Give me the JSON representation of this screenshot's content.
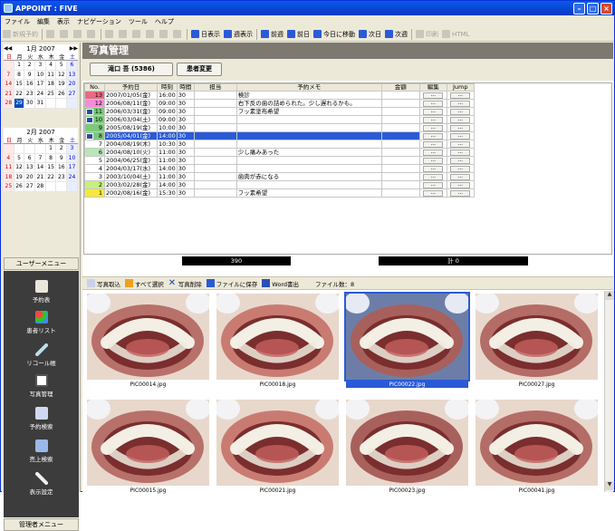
{
  "window": {
    "title": "APPOINT : FIVE"
  },
  "menu": [
    "ファイル",
    "編集",
    "表示",
    "ナビゲーション",
    "ツール",
    "ヘルプ"
  ],
  "toolbar": [
    {
      "label": "新規予約",
      "enabled": false
    },
    {
      "label": "日表示",
      "enabled": true
    },
    {
      "label": "週表示",
      "enabled": true
    },
    {
      "label": "前週",
      "enabled": true
    },
    {
      "label": "前日",
      "enabled": true
    },
    {
      "label": "今日に移動",
      "enabled": true
    },
    {
      "label": "次日",
      "enabled": true
    },
    {
      "label": "次週",
      "enabled": true
    },
    {
      "label": "印刷",
      "enabled": false
    },
    {
      "label": "HTML",
      "enabled": false
    }
  ],
  "calendars": [
    {
      "title": "1月 2007",
      "weekdays": [
        "日",
        "月",
        "火",
        "水",
        "木",
        "金",
        "土"
      ],
      "rows": [
        [
          "",
          "1",
          "2",
          "3",
          "4",
          "5",
          "6"
        ],
        [
          "7",
          "8",
          "9",
          "10",
          "11",
          "12",
          "13"
        ],
        [
          "14",
          "15",
          "16",
          "17",
          "18",
          "19",
          "20"
        ],
        [
          "21",
          "22",
          "23",
          "24",
          "25",
          "26",
          "27"
        ],
        [
          "28",
          "29",
          "30",
          "31",
          "",
          "",
          ""
        ]
      ],
      "today": "29"
    },
    {
      "title": "2月 2007",
      "weekdays": [
        "日",
        "月",
        "火",
        "水",
        "木",
        "金",
        "土"
      ],
      "rows": [
        [
          "",
          "",
          "",
          "",
          "1",
          "2",
          "3"
        ],
        [
          "4",
          "5",
          "6",
          "7",
          "8",
          "9",
          "10"
        ],
        [
          "11",
          "12",
          "13",
          "14",
          "15",
          "16",
          "17"
        ],
        [
          "18",
          "19",
          "20",
          "21",
          "22",
          "23",
          "24"
        ],
        [
          "25",
          "26",
          "27",
          "28",
          "",
          "",
          ""
        ]
      ]
    }
  ],
  "user_menu": {
    "header": "ユーザーメニュー",
    "items": [
      "予約表",
      "患者リスト",
      "リコール帳",
      "写真管理",
      "予約検索",
      "売上検索",
      "表示設定"
    ]
  },
  "admin_menu": {
    "header": "管理者メニュー"
  },
  "page": {
    "title": "写真管理"
  },
  "patient": {
    "name_button": "滝口 吾 (5386)",
    "change_button": "患者変更"
  },
  "table": {
    "headers": [
      "No.",
      "予約日",
      "時刻",
      "時間",
      "担当",
      "予約メモ",
      "金額",
      "編集",
      "Jump"
    ],
    "rows": [
      {
        "no": "13",
        "date": "2007/01/05(金)",
        "time": "16:00",
        "dur": "30",
        "staff": "",
        "memo": "検診",
        "amount": "",
        "color": "#e86a84",
        "icon": false,
        "selected": false
      },
      {
        "no": "12",
        "date": "2006/08/11(金)",
        "time": "09:00",
        "dur": "30",
        "staff": "",
        "memo": "右下反の歯の詰められた。少し遅れるかも。",
        "amount": "",
        "color": "#f28dd7",
        "icon": false,
        "selected": false
      },
      {
        "no": "11",
        "date": "2006/03/31(金)",
        "time": "09:00",
        "dur": "30",
        "staff": "",
        "memo": "フッ素塗布希望",
        "amount": "",
        "color": "#7cc97c",
        "icon": true,
        "selected": false
      },
      {
        "no": "10",
        "date": "2006/03/04(土)",
        "time": "09:00",
        "dur": "30",
        "staff": "",
        "memo": "",
        "amount": "",
        "color": "#7cc97c",
        "icon": true,
        "selected": false
      },
      {
        "no": "9",
        "date": "2005/08/19(金)",
        "time": "10:00",
        "dur": "30",
        "staff": "",
        "memo": "",
        "amount": "",
        "color": "#7cc97c",
        "icon": false,
        "selected": false
      },
      {
        "no": "8",
        "date": "2005/04/01(金)",
        "time": "14:00",
        "dur": "30",
        "staff": "",
        "memo": "",
        "amount": "",
        "color": "#7cc97c",
        "icon": true,
        "selected": true
      },
      {
        "no": "7",
        "date": "2004/08/19(木)",
        "time": "10:30",
        "dur": "30",
        "staff": "",
        "memo": "",
        "amount": "",
        "color": "#ffffff",
        "icon": false,
        "selected": false
      },
      {
        "no": "6",
        "date": "2004/08/10(火)",
        "time": "11:00",
        "dur": "30",
        "staff": "",
        "memo": "少し痛みあった",
        "amount": "",
        "color": "#b8e6b8",
        "icon": false,
        "selected": false
      },
      {
        "no": "5",
        "date": "2004/06/25(金)",
        "time": "11:00",
        "dur": "30",
        "staff": "",
        "memo": "",
        "amount": "",
        "color": "#ffffff",
        "icon": false,
        "selected": false
      },
      {
        "no": "4",
        "date": "2004/03/17(水)",
        "time": "14:00",
        "dur": "30",
        "staff": "",
        "memo": "",
        "amount": "",
        "color": "#ffffff",
        "icon": false,
        "selected": false
      },
      {
        "no": "3",
        "date": "2003/10/04(土)",
        "time": "11:00",
        "dur": "30",
        "staff": "",
        "memo": "歯肉が赤になる",
        "amount": "",
        "color": "#ffffff",
        "icon": false,
        "selected": false
      },
      {
        "no": "2",
        "date": "2003/02/28(金)",
        "time": "14:00",
        "dur": "30",
        "staff": "",
        "memo": "",
        "amount": "",
        "color": "#c8f07a",
        "icon": false,
        "selected": false
      },
      {
        "no": "1",
        "date": "2002/08/16(金)",
        "time": "15:30",
        "dur": "30",
        "staff": "",
        "memo": "フッ素希望",
        "amount": "",
        "color": "#f5e83c",
        "icon": false,
        "selected": false
      }
    ],
    "edit_button": "...",
    "jump_button": "..."
  },
  "counts": {
    "left": "390",
    "right": "計 0"
  },
  "photo_toolbar": {
    "import": "写真取込",
    "select_all": "すべて選択",
    "delete": "写真削除",
    "save_file": "ファイルに保存",
    "word": "Word書出",
    "file_count": "ファイル数：8"
  },
  "photos": [
    {
      "file": "PIC00014.jpg",
      "selected": false
    },
    {
      "file": "PIC00018.jpg",
      "selected": false
    },
    {
      "file": "PIC00022.jpg",
      "selected": true
    },
    {
      "file": "PIC00027.jpg",
      "selected": false
    },
    {
      "file": "PIC00015.jpg",
      "selected": false
    },
    {
      "file": "PIC00021.jpg",
      "selected": false
    },
    {
      "file": "PIC00023.jpg",
      "selected": false
    },
    {
      "file": "PIC00041.jpg",
      "selected": false
    }
  ],
  "colors": {
    "accent": "#2a5bd7",
    "title_bar": "#0a44d4",
    "page_header": "#7d7870",
    "menu_bg": "#3c3c3c"
  }
}
